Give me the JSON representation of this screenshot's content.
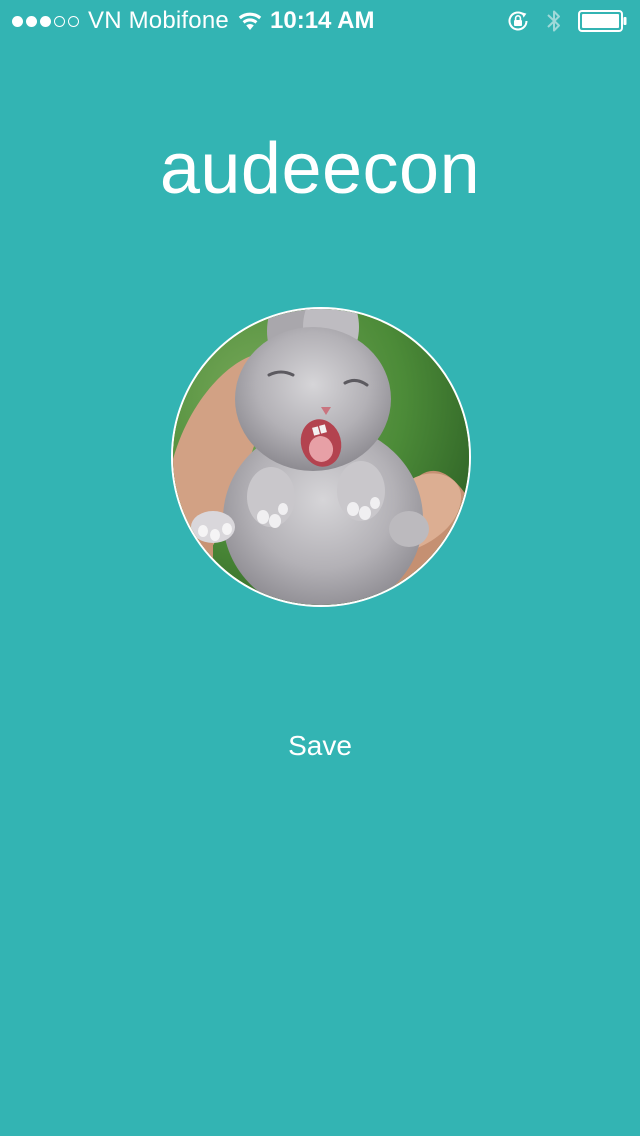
{
  "status_bar": {
    "signal_strength": 3,
    "signal_max": 5,
    "carrier": "VN Mobifone",
    "time": "10:14 AM",
    "icons": [
      "wifi-icon",
      "orientation-lock-icon",
      "bluetooth-icon",
      "battery-icon"
    ],
    "battery_level": 1.0
  },
  "profile": {
    "username": "audeecon",
    "avatar_subject": "rabbit-photo"
  },
  "actions": {
    "save_label": "Save"
  },
  "colors": {
    "background": "#33b4b3",
    "text": "#ffffff"
  }
}
